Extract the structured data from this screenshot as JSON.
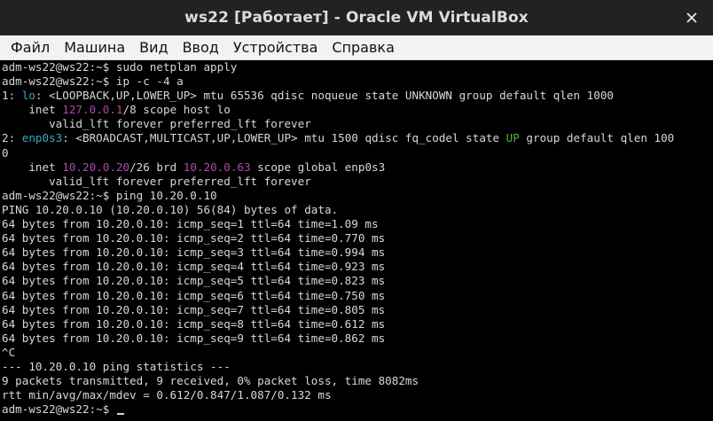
{
  "window": {
    "title": "ws22 [Работает] - Oracle VM VirtualBox",
    "close_icon": "close-icon"
  },
  "menu": {
    "items": [
      {
        "label": "Файл"
      },
      {
        "label": "Машина"
      },
      {
        "label": "Вид"
      },
      {
        "label": "Ввод"
      },
      {
        "label": "Устройства"
      },
      {
        "label": "Справка"
      }
    ]
  },
  "colors": {
    "title_bg": "#222222",
    "menu_bg": "#f2f2f2",
    "terminal_bg": "#000000",
    "text": "#d8d8d8",
    "cyan": "#3aa7c4",
    "magenta": "#b048a8",
    "green": "#4fb82f"
  },
  "terminal": {
    "lines": [
      [
        {
          "t": "adm-ws22@ws22:~$ sudo netplan apply",
          "c": "default"
        }
      ],
      [
        {
          "t": "adm-ws22@ws22:~$ ip -c -4 a",
          "c": "default"
        }
      ],
      [
        {
          "t": "1: ",
          "c": "default"
        },
        {
          "t": "lo",
          "c": "cyan"
        },
        {
          "t": ": <LOOPBACK,UP,LOWER_UP> mtu 65536 qdisc noqueue state UNKNOWN group default qlen 1000",
          "c": "default"
        }
      ],
      [
        {
          "t": "    inet ",
          "c": "default"
        },
        {
          "t": "127.0.0.1",
          "c": "magenta"
        },
        {
          "t": "/8 scope host lo",
          "c": "default"
        }
      ],
      [
        {
          "t": "       valid_lft forever preferred_lft forever",
          "c": "default"
        }
      ],
      [
        {
          "t": "2: ",
          "c": "default"
        },
        {
          "t": "enp0s3",
          "c": "cyan"
        },
        {
          "t": ": <BROADCAST,MULTICAST,UP,LOWER_UP> mtu 1500 qdisc fq_codel state ",
          "c": "default"
        },
        {
          "t": "UP",
          "c": "green"
        },
        {
          "t": " group default qlen 100",
          "c": "default"
        }
      ],
      [
        {
          "t": "0",
          "c": "default"
        }
      ],
      [
        {
          "t": "    inet ",
          "c": "default"
        },
        {
          "t": "10.20.0.20",
          "c": "magenta"
        },
        {
          "t": "/26 brd ",
          "c": "default"
        },
        {
          "t": "10.20.0.63",
          "c": "magenta"
        },
        {
          "t": " scope global enp0s3",
          "c": "default"
        }
      ],
      [
        {
          "t": "       valid_lft forever preferred_lft forever",
          "c": "default"
        }
      ],
      [
        {
          "t": "adm-ws22@ws22:~$ ping 10.20.0.10",
          "c": "default"
        }
      ],
      [
        {
          "t": "PING 10.20.0.10 (10.20.0.10) 56(84) bytes of data.",
          "c": "default"
        }
      ],
      [
        {
          "t": "64 bytes from 10.20.0.10: icmp_seq=1 ttl=64 time=1.09 ms",
          "c": "default"
        }
      ],
      [
        {
          "t": "64 bytes from 10.20.0.10: icmp_seq=2 ttl=64 time=0.770 ms",
          "c": "default"
        }
      ],
      [
        {
          "t": "64 bytes from 10.20.0.10: icmp_seq=3 ttl=64 time=0.994 ms",
          "c": "default"
        }
      ],
      [
        {
          "t": "64 bytes from 10.20.0.10: icmp_seq=4 ttl=64 time=0.923 ms",
          "c": "default"
        }
      ],
      [
        {
          "t": "64 bytes from 10.20.0.10: icmp_seq=5 ttl=64 time=0.823 ms",
          "c": "default"
        }
      ],
      [
        {
          "t": "64 bytes from 10.20.0.10: icmp_seq=6 ttl=64 time=0.750 ms",
          "c": "default"
        }
      ],
      [
        {
          "t": "64 bytes from 10.20.0.10: icmp_seq=7 ttl=64 time=0.805 ms",
          "c": "default"
        }
      ],
      [
        {
          "t": "64 bytes from 10.20.0.10: icmp_seq=8 ttl=64 time=0.612 ms",
          "c": "default"
        }
      ],
      [
        {
          "t": "64 bytes from 10.20.0.10: icmp_seq=9 ttl=64 time=0.862 ms",
          "c": "default"
        }
      ],
      [
        {
          "t": "^C",
          "c": "default"
        }
      ],
      [
        {
          "t": "--- 10.20.0.10 ping statistics ---",
          "c": "default"
        }
      ],
      [
        {
          "t": "9 packets transmitted, 9 received, 0% packet loss, time 8082ms",
          "c": "default"
        }
      ],
      [
        {
          "t": "rtt min/avg/max/mdev = 0.612/0.847/1.087/0.132 ms",
          "c": "default"
        }
      ],
      [
        {
          "t": "adm-ws22@ws22:~$ ",
          "c": "default"
        }
      ]
    ],
    "cursor_line": 24
  }
}
